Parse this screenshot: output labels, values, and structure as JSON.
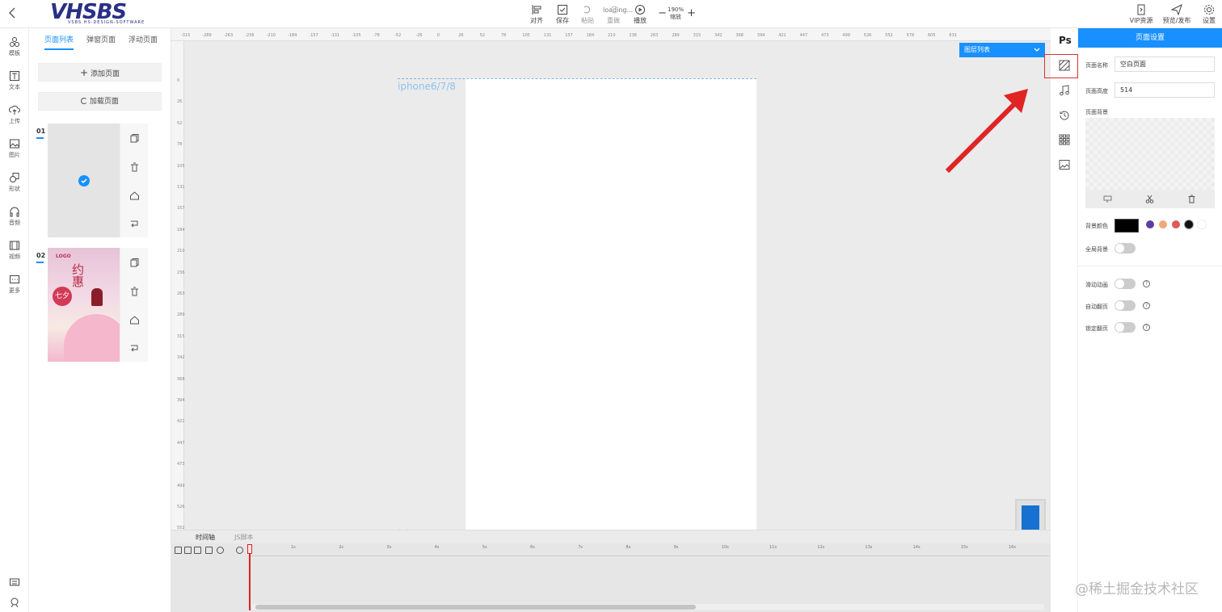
{
  "topbar": {
    "logo_text": "VHSBS",
    "logo_sub": "VSBS.HS-DESIGN-SOFTWARE",
    "tools": [
      {
        "label": "对齐",
        "icon": "align-icon"
      },
      {
        "label": "保存",
        "icon": "save-icon"
      },
      {
        "label": "粘贴",
        "icon": "paste-icon"
      },
      {
        "label": "重做",
        "icon": "redo-icon"
      },
      {
        "label": "播放",
        "icon": "play-icon"
      }
    ],
    "loading_text": "loading...",
    "zoom_value": "190%",
    "zoom_label": "缩放",
    "vip_label": "VIP资源",
    "publish_label": "预览/发布",
    "settings_label": "设置"
  },
  "leftnav": {
    "items": [
      {
        "label": "模板",
        "icon": "template-icon"
      },
      {
        "label": "文本",
        "icon": "text-icon"
      },
      {
        "label": "上传",
        "icon": "upload-icon"
      },
      {
        "label": "图片",
        "icon": "image-icon"
      },
      {
        "label": "形状",
        "icon": "shape-icon"
      },
      {
        "label": "音频",
        "icon": "audio-icon"
      },
      {
        "label": "视频",
        "icon": "video-icon"
      },
      {
        "label": "更多",
        "icon": "more-icon"
      }
    ]
  },
  "pagepanel": {
    "tabs": [
      "页面列表",
      "弹窗页面",
      "浮动页面"
    ],
    "add_page": "添加页面",
    "load_page": "加载页面",
    "pages": [
      {
        "number": "01"
      },
      {
        "number": "02",
        "poster_logo": "LOGO",
        "poster_title": "约惠",
        "poster_big": "七夕"
      }
    ]
  },
  "canvas": {
    "device_label": "iphone6/7/8",
    "layer_dropdown": "图层列表",
    "ruler_h": [
      "-315",
      "-289",
      "-263",
      "-236",
      "-210",
      "-184",
      "-157",
      "-131",
      "-105",
      "-78",
      "-52",
      "-26",
      "0",
      "26",
      "52",
      "78",
      "105",
      "131",
      "157",
      "184",
      "210",
      "236",
      "263",
      "289",
      "315",
      "342",
      "368",
      "394",
      "421",
      "447",
      "473",
      "499",
      "526",
      "552",
      "578",
      "605",
      "631"
    ],
    "ruler_v": [
      "0",
      "26",
      "52",
      "78",
      "105",
      "131",
      "157",
      "184",
      "210",
      "236",
      "263",
      "289",
      "315",
      "342",
      "368",
      "394",
      "421",
      "447",
      "473",
      "499",
      "526",
      "552"
    ]
  },
  "timeline": {
    "tabs": [
      "时间轴",
      "JS脚本"
    ],
    "seconds": [
      "1s",
      "2s",
      "3s",
      "4s",
      "5s",
      "6s",
      "7s",
      "8s",
      "9s",
      "10s",
      "11s",
      "12s",
      "13s",
      "14s",
      "15s",
      "16s"
    ]
  },
  "iconstrip": {
    "ps_label": "Ps",
    "icons": [
      "background-icon",
      "music-icon",
      "history-icon",
      "grid-icon",
      "image-icon"
    ]
  },
  "settings": {
    "header": "页面设置",
    "page_name_label": "页面名称",
    "page_name_value": "空白页面",
    "page_height_label": "页面高度",
    "page_height_value": "514",
    "page_bg_label": "页面背景",
    "bg_color_label": "背景颜色",
    "swatches": [
      "#000000",
      "#5a3fa0",
      "#f0a878",
      "#e05858",
      "#111111",
      "#ffffff"
    ],
    "global_bg_label": "全局背景",
    "slide_anim_label": "滑动动画",
    "auto_flip_label": "自动翻页",
    "lock_flip_label": "锁定翻页"
  },
  "watermark": "@稀土掘金技术社区"
}
